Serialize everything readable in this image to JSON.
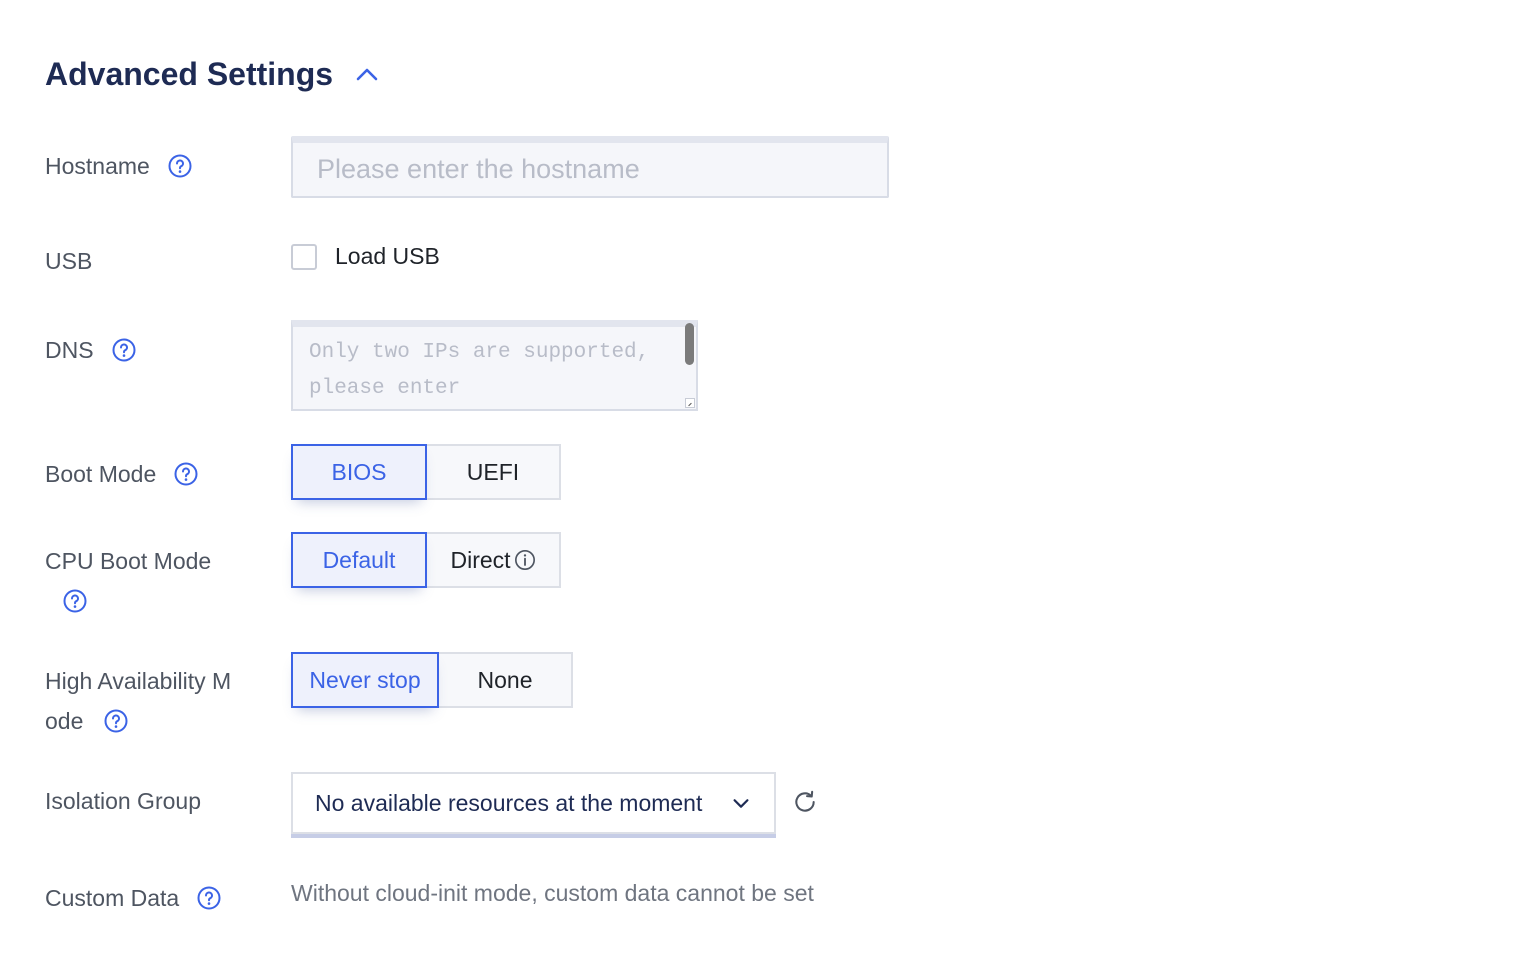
{
  "section": {
    "title": "Advanced Settings",
    "collapse_icon": "chevron-up-icon"
  },
  "hostname": {
    "label": "Hostname",
    "placeholder": "Please enter the hostname",
    "value": ""
  },
  "usb": {
    "label": "USB",
    "checkbox_label": "Load USB",
    "checked": false
  },
  "dns": {
    "label": "DNS",
    "placeholder": "Only two IPs are supported, please enter"
  },
  "boot_mode": {
    "label": "Boot Mode",
    "options": [
      "BIOS",
      "UEFI"
    ],
    "selected": "BIOS"
  },
  "cpu_boot_mode": {
    "label": "CPU Boot Mode",
    "options": [
      "Default",
      "Direct"
    ],
    "selected": "Default",
    "info_icon": "info-circle-icon"
  },
  "ha_mode": {
    "label": "High Availability Mode",
    "label_line1": "High Availability M",
    "label_line2": "ode",
    "options": [
      "Never stop",
      "None"
    ],
    "selected": "Never stop"
  },
  "isolation_group": {
    "label": "Isolation Group",
    "value": "No available resources at the moment",
    "refresh_icon": "refresh-icon"
  },
  "custom_data": {
    "label": "Custom Data",
    "note": "Without cloud-init mode, custom data cannot be set"
  },
  "colors": {
    "accent": "#3b63e6",
    "title": "#1e2b54",
    "label": "#4e5561"
  }
}
